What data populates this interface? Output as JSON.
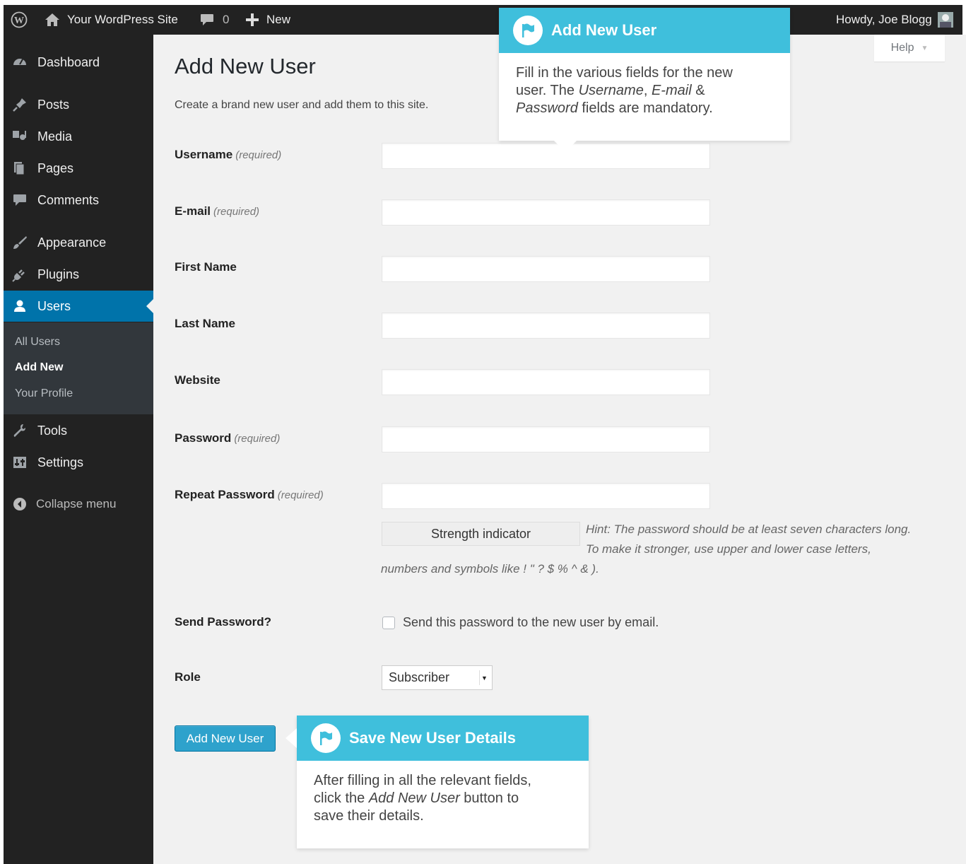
{
  "admin_bar": {
    "wp_logo_icon": "wordpress-logo-icon",
    "site_name": "Your WordPress Site",
    "comments_count": "0",
    "new_label": "New",
    "greeting": "Howdy, Joe Blogg"
  },
  "sidebar": {
    "items": [
      {
        "label": "Dashboard",
        "icon": "dashboard-icon"
      },
      {
        "label": "Posts",
        "icon": "pin-icon"
      },
      {
        "label": "Media",
        "icon": "media-icon"
      },
      {
        "label": "Pages",
        "icon": "pages-icon"
      },
      {
        "label": "Comments",
        "icon": "comment-icon"
      },
      {
        "label": "Appearance",
        "icon": "brush-icon"
      },
      {
        "label": "Plugins",
        "icon": "plug-icon"
      },
      {
        "label": "Users",
        "icon": "user-icon"
      },
      {
        "label": "Tools",
        "icon": "wrench-icon"
      },
      {
        "label": "Settings",
        "icon": "settings-icon"
      }
    ],
    "submenu": [
      "All Users",
      "Add New",
      "Your Profile"
    ],
    "collapse_label": "Collapse menu"
  },
  "help_tab": "Help",
  "page": {
    "title": "Add New User",
    "description": "Create a brand new user and add them to this site."
  },
  "form": {
    "required_label": "(required)",
    "fields": {
      "username": "Username",
      "email": "E-mail",
      "first_name": "First Name",
      "last_name": "Last Name",
      "website": "Website",
      "password": "Password",
      "repeat_password": "Repeat Password"
    },
    "strength_indicator": "Strength indicator",
    "hint_line1": "Hint: The password should be at least seven characters long.",
    "hint_line2": "To make it stronger, use upper and lower case letters,",
    "hint_line3": "numbers and symbols like ! \" ? $ % ^ & ).",
    "send_password_label": "Send Password?",
    "send_password_text": "Send this password to the new user by email.",
    "role_label": "Role",
    "role_value": "Subscriber",
    "submit_label": "Add New User"
  },
  "pointers": {
    "add_user": {
      "title": "Add New User",
      "line1": "Fill in the various fields for the new",
      "line2_pre": "user. The ",
      "line2_username": "Username",
      "line2_sep": ", ",
      "line2_email": "E-mail",
      "line2_amp": " &",
      "line3_password": "Password",
      "line3_post": " fields are mandatory."
    },
    "save_user": {
      "title": "Save New User Details",
      "line1": "After filling in all the relevant fields,",
      "line2_pre": "click the ",
      "line2_em": "Add New User",
      "line2_post": " button to",
      "line3": "save their details."
    }
  },
  "colors": {
    "admin_dark": "#222222",
    "accent": "#0073aa",
    "pointer_header": "#3fbfdc",
    "button": "#2ea2cc",
    "content_bg": "#f1f1f1"
  }
}
